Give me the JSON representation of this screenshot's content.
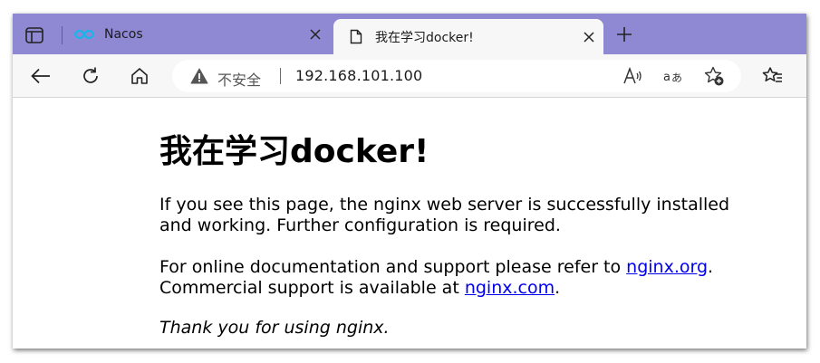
{
  "tabs": [
    {
      "title": "Nacos",
      "favicon": "nacos-logo-icon",
      "active": false
    },
    {
      "title": "我在学习docker!",
      "favicon": "page-icon",
      "active": true
    }
  ],
  "toolbar": {
    "security_label": "不安全",
    "url": "192.168.101.100",
    "read_aloud_icon": "read-aloud-icon",
    "translate_icon": "translate-icon",
    "add_favorite_icon": "add-favorite-icon",
    "favorites_icon": "favorites-icon"
  },
  "page": {
    "heading": "我在学习docker!",
    "p1": "If you see this page, the nginx web server is successfully installed and working. Further configuration is required.",
    "p2_prefix": "For online documentation and support please refer to ",
    "link1": "nginx.org",
    "p2_mid": ".",
    "p2_line2_prefix": "Commercial support is available at ",
    "link2": "nginx.com",
    "p2_end": ".",
    "p3": "Thank you for using nginx."
  },
  "colors": {
    "tabstrip": "#8f89d4",
    "toolbar": "#f7f7f7",
    "link": "#0000ee"
  }
}
